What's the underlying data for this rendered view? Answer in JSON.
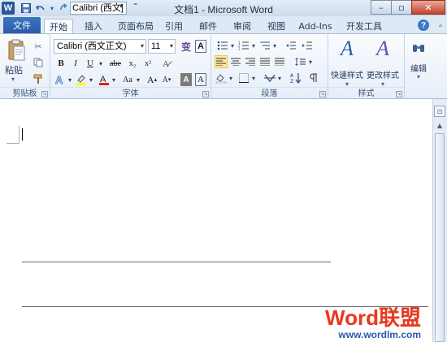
{
  "titlebar": {
    "app_icon_letter": "W",
    "save_icon": "save-icon",
    "undo_icon": "undo-icon",
    "redo_icon": "redo-icon",
    "font_value": "Calibri (西文]",
    "title": "文档1 - Microsoft Word",
    "min_symbol": "–",
    "restore_symbol": "▫",
    "close_symbol": "✕"
  },
  "tabs": {
    "file": "文件",
    "items": [
      "开始",
      "插入",
      "页面布局",
      "引用",
      "邮件",
      "审阅",
      "视图",
      "Add-Ins",
      "开发工具"
    ],
    "active": "开始",
    "help_symbol": "?"
  },
  "ribbon": {
    "clipboard": {
      "label": "剪贴板",
      "paste_label": "粘贴",
      "paste_drop": "▾"
    },
    "font": {
      "label": "字体",
      "font_name": "Calibri (西文正文)",
      "font_size": "11",
      "bold": "B",
      "italic": "I",
      "underline": "U",
      "strike": "abe",
      "subscript": "x₂",
      "superscript": "x²",
      "change_case": "Aa",
      "grow": "A",
      "shrink": "A",
      "wen": "变",
      "clear_format": "A"
    },
    "paragraph": {
      "label": "段落"
    },
    "styles": {
      "label": "样式",
      "quick_styles": "快速样式",
      "change_styles": "更改样式"
    },
    "editing": {
      "label": "编辑"
    }
  },
  "watermark": {
    "title_a": "Word",
    "title_b": "联盟",
    "url": "www.wordlm.com"
  }
}
